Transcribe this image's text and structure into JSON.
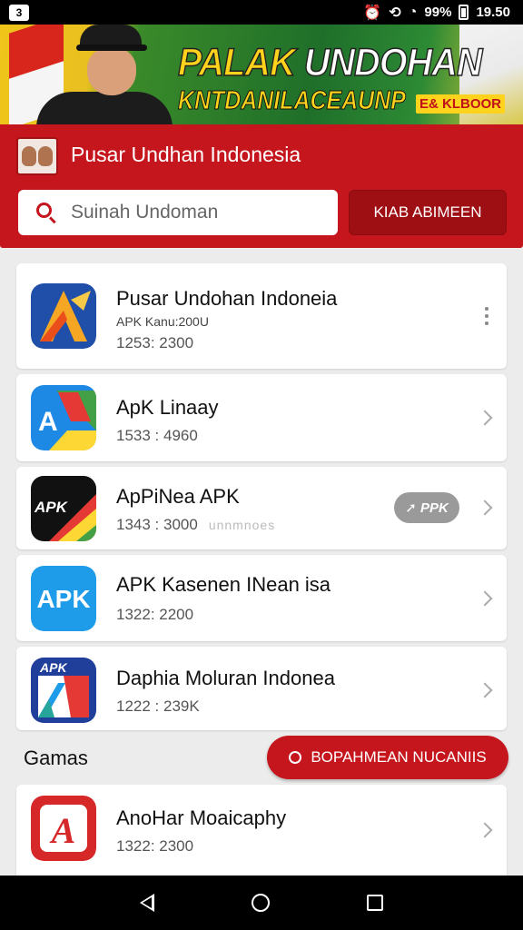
{
  "status_bar": {
    "left_badge": "3",
    "alarm_icon": "alarm-icon",
    "battery": "99%",
    "time": "19.50"
  },
  "banner": {
    "title_part1": "PALAK ",
    "title_part2": "UNDOHAN",
    "subtitle": "KNTDANILACEAUNP",
    "tag": "E& KLBOOR"
  },
  "header": {
    "title": "Pusar Undhan Indonesia",
    "search_placeholder": "Suinah Undoman",
    "search_button": "KIAB ABIMEEN"
  },
  "apps": [
    {
      "name": "Pusar Undohan Indoneia",
      "sub": "APK Kanu:200U",
      "meta": "1253: 2300",
      "trailing": "more"
    },
    {
      "name": "ApK Linaay",
      "meta": "1533 : 4960",
      "trailing": "chevron"
    },
    {
      "name": "ApPiNea APK",
      "meta": "1343 : 3000",
      "blur": "unnmnoes",
      "pill": "PPK",
      "trailing": "chevron"
    },
    {
      "name": "APK Kasenen INean isa",
      "meta": "1322: 2200",
      "trailing": "chevron"
    },
    {
      "name": "Daphia Moluran Indonea",
      "meta": "1222 : 239K",
      "trailing": "chevron"
    }
  ],
  "section": {
    "title": "Gamas",
    "action_button": "BOPAHMEAN NUCANIIS"
  },
  "game_apps": [
    {
      "name": "AnoHar Moaicaphy",
      "meta": "1322: 2300",
      "trailing": "chevron"
    }
  ],
  "icon_labels": {
    "apk_blue": "APK",
    "apk_dark": "APK",
    "apk_small": "APK",
    "google_like": "A",
    "red_app": "A"
  },
  "colors": {
    "primary_red": "#c4161c",
    "dark_red": "#9e0f14",
    "background": "#ececec"
  }
}
